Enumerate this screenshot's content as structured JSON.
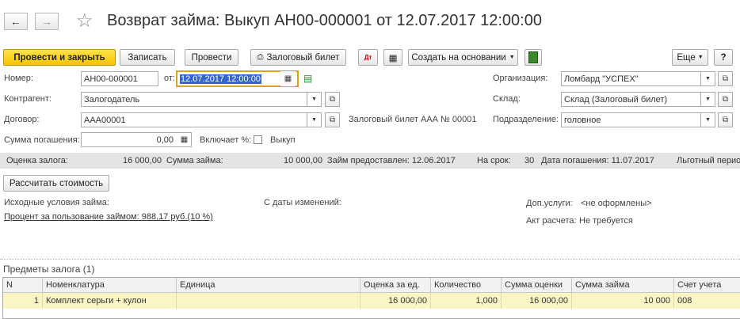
{
  "header": {
    "title": "Возврат займа: Выкуп АН00-000001 от 12.07.2017 12:00:00"
  },
  "toolbar": {
    "post_close": "Провести и закрыть",
    "save": "Записать",
    "post": "Провести",
    "pledge_ticket": "Залоговый билет",
    "create_based_on": "Создать на основании",
    "more": "Еще",
    "help": "?"
  },
  "form": {
    "number_label": "Номер:",
    "number_value": "АН00-000001",
    "from_label": "от:",
    "date_value": "12.07.2017 12:00:00",
    "org_label": "Организация:",
    "org_value": "Ломбард \"УСПЕХ\"",
    "contractor_label": "Контрагент:",
    "contractor_value": "Залогодатель",
    "warehouse_label": "Склад:",
    "warehouse_value": "Склад (Залоговый билет)",
    "contract_label": "Договор:",
    "contract_value": "ААА00001",
    "ticket_info": "Залоговый билет ААА № 00001",
    "division_label": "Подразделение:",
    "division_value": "головное",
    "amount_label": "Сумма погашения:",
    "amount_value": "0,00",
    "includes_label": "Включает %:",
    "redemption_label": "Выкуп"
  },
  "infobar": {
    "pledge_label": "Оценка залога:",
    "pledge_value": "16 000,00",
    "loan_label": "Сумма займа:",
    "loan_value": "10 000,00",
    "issued_label": "Займ предоставлен: 12.06.2017",
    "term_label": "На срок:",
    "term_value": "30",
    "due_label": "Дата погашения: 11.07.2017",
    "grace_label": "Льготный перио"
  },
  "calc_button": "Рассчитать стоимость",
  "conditions": {
    "initial_label": "Исходные условия займа:",
    "interest_link": "Процент за пользование займом: 988,17 руб.(10 %)",
    "changes_label": "С даты изменений:",
    "services_label": "Доп.услуги:",
    "services_value": "<не оформлены>",
    "act_label": "Акт расчета:",
    "act_value": "Не требуется"
  },
  "items": {
    "title": "Предметы залога (1)",
    "columns": [
      "N",
      "Номенклатура",
      "Единица",
      "Оценка за ед.",
      "Количество",
      "Сумма оценки",
      "Сумма займа",
      "Счет учета"
    ],
    "rows": [
      [
        "1",
        "Комплект серьги + кулон",
        "",
        "16 000,00",
        "1,000",
        "16 000,00",
        "10 000",
        "008"
      ]
    ]
  }
}
